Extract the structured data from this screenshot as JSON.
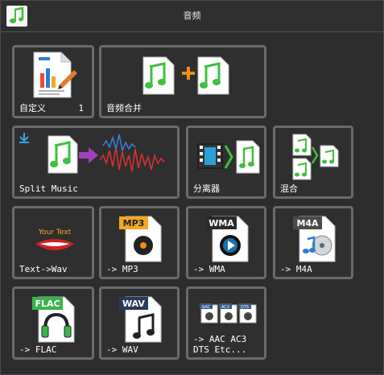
{
  "window": {
    "title": "音频"
  },
  "tiles": {
    "custom": {
      "label": "自定义",
      "count": "1"
    },
    "merge": {
      "label": "音频合并"
    },
    "split": {
      "label": "Split Music"
    },
    "separator": {
      "label": "分离器"
    },
    "mix": {
      "label": "混合"
    },
    "tts": {
      "label": "Text->Wav",
      "icon_text": "Your Text"
    },
    "mp3": {
      "label": "-> MP3",
      "badge": "MP3"
    },
    "wma": {
      "label": "-> WMA",
      "badge": "WMA"
    },
    "m4a": {
      "label": "-> M4A",
      "badge": "M4A"
    },
    "flac": {
      "label": "-> FLAC",
      "badge": "FLAC"
    },
    "wav": {
      "label": "-> WAV",
      "badge": "WAV"
    },
    "other": {
      "label": "-> AAC AC3\nDTS Etc...",
      "badges": [
        "AAC",
        "AC3",
        "DTS"
      ]
    }
  },
  "colors": {
    "tile_border": "#6a6a6a",
    "note_green": "#3fbf3f",
    "plus_orange": "#f28c1a",
    "wave_red": "#d43030",
    "wave_blue": "#3a7bd5",
    "mp3_badge": "#f5a623",
    "wma_badge": "#2a2a2a",
    "m4a_badge": "#4a4a4a",
    "flac_badge": "#39b54a",
    "wav_badge": "#2a3a5a"
  }
}
